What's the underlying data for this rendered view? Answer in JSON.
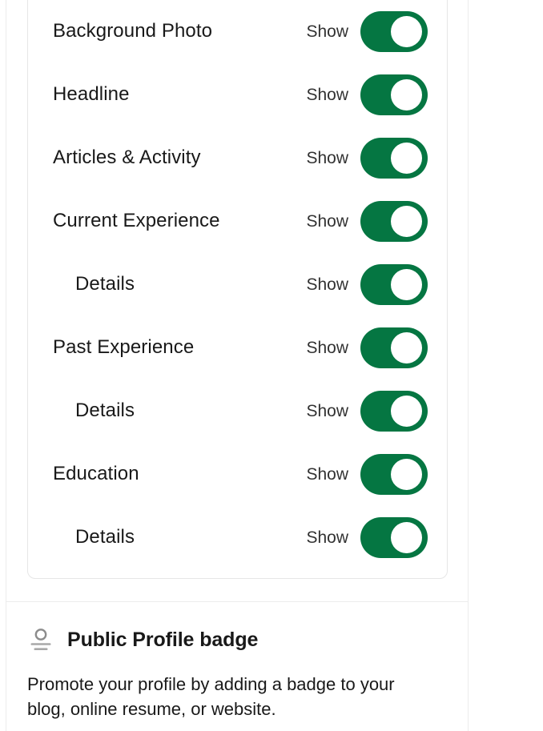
{
  "settings_card": {
    "rows": [
      {
        "label": "Background Photo",
        "state": "Show",
        "indented": false,
        "toggle_on": true
      },
      {
        "label": "Headline",
        "state": "Show",
        "indented": false,
        "toggle_on": true
      },
      {
        "label": "Articles & Activity",
        "state": "Show",
        "indented": false,
        "toggle_on": true
      },
      {
        "label": "Current Experience",
        "state": "Show",
        "indented": false,
        "toggle_on": true
      },
      {
        "label": "Details",
        "state": "Show",
        "indented": true,
        "toggle_on": true
      },
      {
        "label": "Past Experience",
        "state": "Show",
        "indented": false,
        "toggle_on": true
      },
      {
        "label": "Details",
        "state": "Show",
        "indented": true,
        "toggle_on": true
      },
      {
        "label": "Education",
        "state": "Show",
        "indented": false,
        "toggle_on": true
      },
      {
        "label": "Details",
        "state": "Show",
        "indented": true,
        "toggle_on": true
      }
    ]
  },
  "badge_section": {
    "icon": "public-profile-badge-icon",
    "title": "Public Profile badge",
    "description": "Promote your profile by adding a badge to your blog, online resume, or website."
  },
  "colors": {
    "toggle_on": "#057642",
    "toggle_knob": "#ffffff",
    "text_primary": "#191919",
    "text_secondary": "#323232",
    "border": "#e6e6e6",
    "divider": "#ececec",
    "background": "#ffffff"
  }
}
